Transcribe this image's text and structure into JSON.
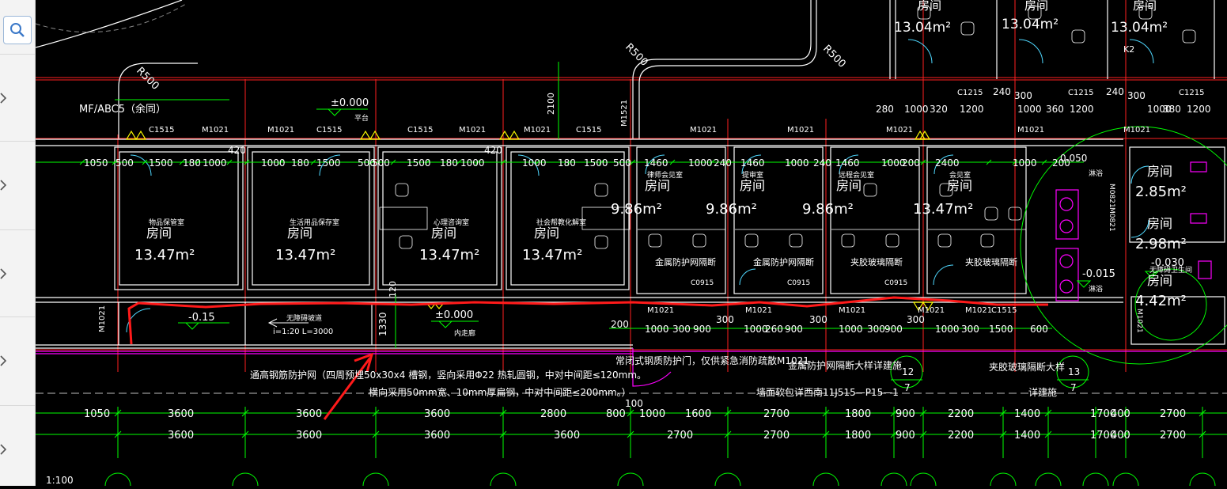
{
  "sidebar": {
    "search_icon": "search-icon",
    "chevrons": [
      "chevron-right-icon",
      "chevron-right-icon",
      "chevron-right-icon",
      "chevron-right-icon",
      "chevron-right-icon",
      "chevron-right-icon"
    ]
  },
  "colors": {
    "wall": "#ffffff",
    "dim": "#00ff00",
    "axis": "#ff2020",
    "text": "#ffffff",
    "yellow": "#ffff00",
    "magenta": "#ff00ff",
    "markup": "#ff1a1a"
  },
  "drawing": {
    "scale": "1:100",
    "top_labels": {
      "mf": "MF/ABC5（余同）",
      "elev0": "±0.000",
      "platform": "平台",
      "r1": "R500",
      "r2": "R500",
      "r3": "R500",
      "d2100": "2100",
      "m1521": "M1521",
      "k2": "K2"
    },
    "top_rooms": [
      {
        "name": "房间",
        "area": "13.04m²"
      },
      {
        "name": "房间",
        "area": "13.04m²"
      },
      {
        "name": "房间",
        "area": "13.04m²"
      }
    ],
    "top_dims": [
      "280",
      "1000",
      "320",
      "1200",
      "240",
      "300",
      "1000",
      "360",
      "1200",
      "240",
      "300",
      "1000",
      "380",
      "1200"
    ],
    "door_labels_top": [
      "C1515",
      "M1021",
      "M1021",
      "C1515",
      "C1515",
      "M1021",
      "M1021",
      "C1515",
      "M1021",
      "M1021",
      "M1021",
      "C1215",
      "M1021",
      "C1215",
      "M1021",
      "C1215",
      "M1021",
      "M1021"
    ],
    "dims_row1": [
      "1050",
      "500",
      "1500",
      "180",
      "1000",
      "420",
      "1000",
      "180",
      "1500",
      "500",
      "500",
      "1500",
      "180",
      "1000",
      "420",
      "1000",
      "180",
      "1500",
      "500",
      "1460",
      "1000",
      "240",
      "1460",
      "1000",
      "240",
      "1460",
      "1000",
      "200",
      "2400",
      "1000",
      "200",
      "0.050"
    ],
    "rooms": [
      {
        "small": "物品保管室",
        "name": "房间",
        "area": "13.47m²"
      },
      {
        "small": "生活用品保存室",
        "name": "房间",
        "area": "13.47m²"
      },
      {
        "small": "心理咨询室",
        "name": "房间",
        "area": "13.47m²"
      },
      {
        "small": "社会帮教化解室",
        "name": "房间",
        "area": "13.47m²"
      },
      {
        "small": "律师会见室",
        "name": "房间",
        "area": "9.86m²"
      },
      {
        "small": "提审室",
        "name": "房间",
        "area": "9.86m²"
      },
      {
        "small": "远程会见室",
        "name": "房间",
        "area": "9.86m²"
      },
      {
        "small": "会见室",
        "name": "房间",
        "area": "13.47m²"
      },
      {
        "small": "",
        "name": "房间",
        "area": "2.85m²"
      },
      {
        "small": "",
        "name": "房间",
        "area": "2.98m²"
      },
      {
        "small": "无障碍卫生间",
        "name": "房间",
        "area": "4.42m²"
      }
    ],
    "partitions": [
      "金属防护网隔断",
      "金属防护网隔断",
      "夹胶玻璃隔断",
      "夹胶玻璃隔断"
    ],
    "c0915": [
      "C0915",
      "C0915",
      "C0915"
    ],
    "corridor": {
      "elev": "-0.15",
      "elev2": "±0.000",
      "inner": "内走廊",
      "ramp": "无障碍坡道",
      "slope": "i=1:20  L=3000",
      "d1330": "1330",
      "d120": "120",
      "m1021": "M1021"
    },
    "right_labels": {
      "m0821": "M0821",
      "m0821b": "M0821",
      "m1021": "M1021",
      "e030": "-0.030",
      "e015": "-0.015",
      "shower": "淋浴",
      "shower2": "淋浴"
    },
    "door_labels_bottom": [
      "M1021",
      "M1021",
      "M1021",
      "M1021",
      "M1021",
      "C1515"
    ],
    "dims_row2": [
      "200",
      "1000",
      "300",
      "900",
      "300",
      "1000",
      "260",
      "900",
      "300",
      "1000",
      "300",
      "900",
      "300",
      "1000",
      "300",
      "1500",
      "600"
    ],
    "notes": {
      "n1": "通高钢筋防护网（四周预埋50x30x4 槽钢，竖向采用Φ22 热轧圆钢，中对中间距≤120mm。",
      "n2": "横向采用50mm宽、10mm厚扁钢，中对中间距≤200mm。）",
      "n3": "常闭式钢质防护门，仅供紧急消防疏散M1021",
      "n4": "金属防护网隔断大样详建施",
      "n5": "墙面软包详西南11J515—P15—1",
      "n6": "夹胶玻璃隔断大样",
      "n7": "详建施",
      "n8": "100",
      "c1top": "12",
      "c1bot": "7",
      "c2top": "13",
      "c2bot": "7"
    },
    "dims_row3": [
      "1050",
      "3600",
      "3600",
      "3600",
      "2800",
      "800",
      "1000",
      "1600",
      "2700",
      "1800",
      "900",
      "2200",
      "1400",
      "1700",
      "400",
      "2700"
    ],
    "dims_row4": [
      "3600",
      "3600",
      "3600",
      "3600",
      "2700",
      "2700",
      "1800",
      "900",
      "2200",
      "1400",
      "1700",
      "400",
      "2700"
    ]
  }
}
